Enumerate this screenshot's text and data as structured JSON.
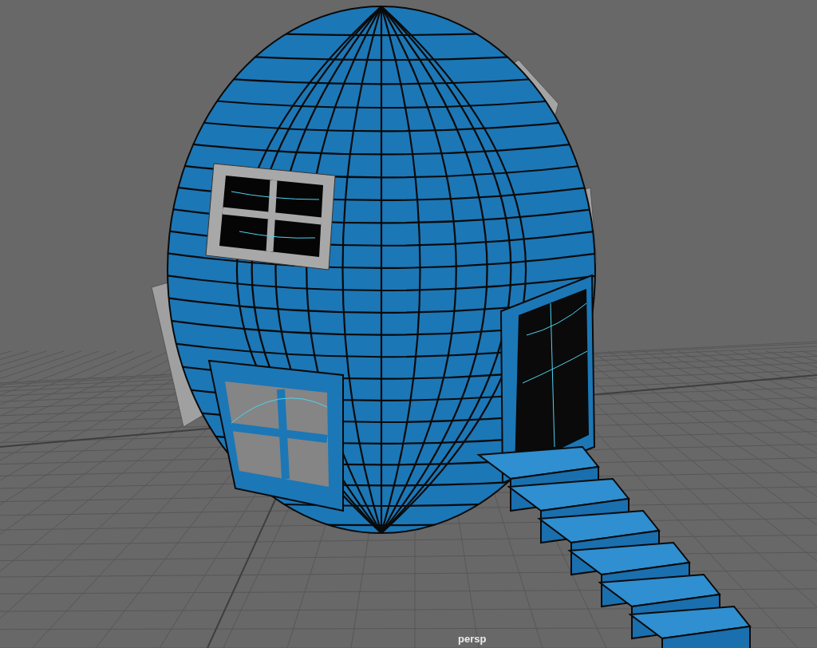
{
  "viewport": {
    "camera_label": "persp"
  }
}
